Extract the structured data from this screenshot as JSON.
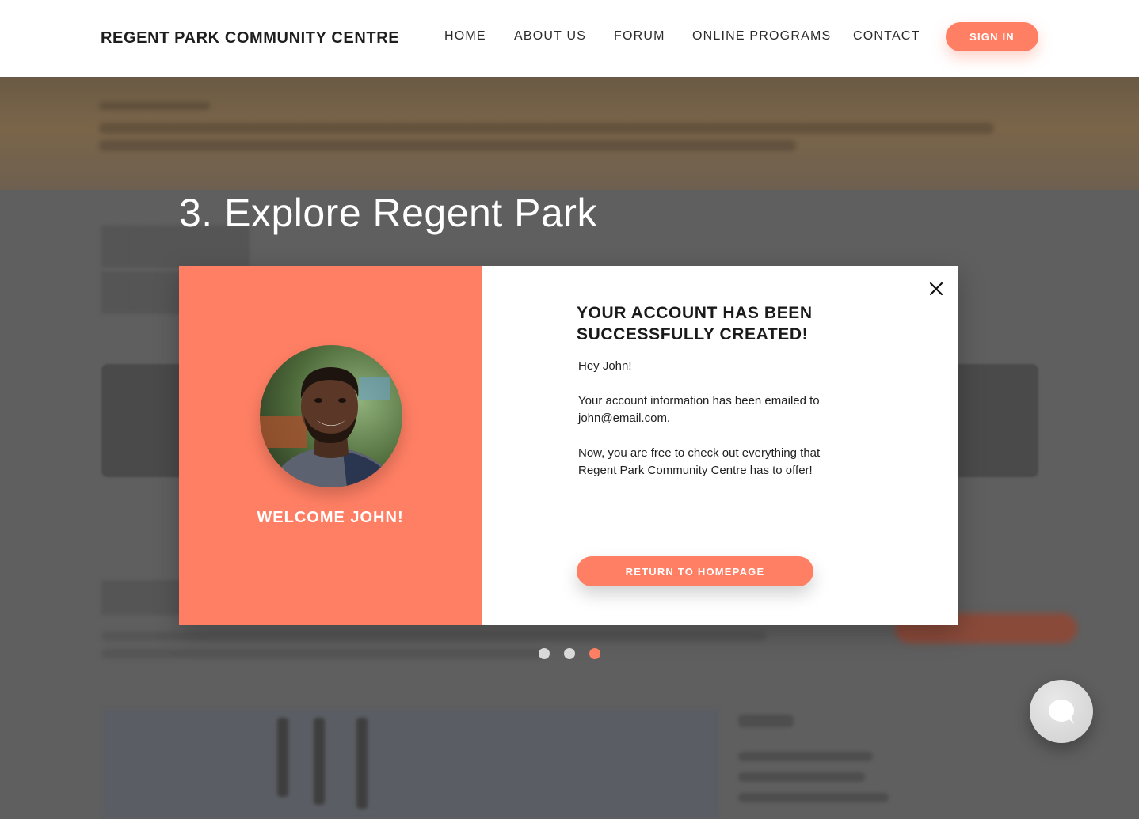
{
  "header": {
    "brand": "REGENT PARK COMMUNITY CENTRE",
    "nav": [
      "HOME",
      "ABOUT US",
      "FORUM",
      "ONLINE PROGRAMS",
      "CONTACT"
    ],
    "signin_label": "SIGN IN"
  },
  "carousel": {
    "title": "3. Explore Regent Park",
    "active_slide": 3,
    "slide_count": 3
  },
  "modal": {
    "welcome": "WELCOME JOHN!",
    "heading_line1": "YOUR ACCOUNT HAS BEEN",
    "heading_line2": "SUCCESSFULLY CREATED!",
    "greeting": "Hey John!",
    "email_line1": "Your account information has been emailed to",
    "email_line2": "john@email.com.",
    "offer_line1": "Now, you are free to check out everything that",
    "offer_line2": "Regent Park Community Centre has to offer!",
    "return_label": "RETURN TO HOMEPAGE"
  },
  "icons": {
    "close": "close-icon",
    "chat": "chat-bubble-icon",
    "avatar": "user-avatar"
  },
  "colors": {
    "accent": "#ff7f64",
    "dot_inactive": "#d9d9d9",
    "overlay": "#5f5f5f"
  }
}
